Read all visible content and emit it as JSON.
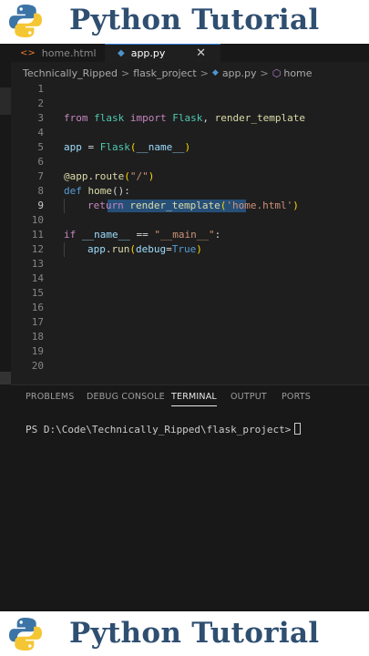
{
  "banner": {
    "title": "Python Tutorial"
  },
  "tabs": [
    {
      "label": "home.html",
      "icon": "<>"
    },
    {
      "label": "app.py",
      "icon": "◆"
    }
  ],
  "breadcrumb": {
    "items": [
      "Technically_Ripped",
      "flask_project",
      "app.py",
      "home"
    ],
    "separator": ">"
  },
  "editor": {
    "line_numbers": [
      "1",
      "2",
      "3",
      "4",
      "5",
      "6",
      "7",
      "8",
      "9",
      "10",
      "11",
      "12",
      "13",
      "14",
      "15",
      "16",
      "17",
      "18",
      "19",
      "20"
    ],
    "code": {
      "l3_from": "from",
      "l3_mod": "flask",
      "l3_import": "import",
      "l3_cls": "Flask",
      "l3_comma": ",",
      "l3_fn": "render_template",
      "l5_app": "app",
      "l5_eq": "=",
      "l5_cls": "Flask",
      "l5_open": "(",
      "l5_name": "__name__",
      "l5_close": ")",
      "l7_dec": "@app.route",
      "l7_open": "(",
      "l7_str": "\"/\"",
      "l7_close": ")",
      "l8_def": "def",
      "l8_fn": "home",
      "l8_rest": "():",
      "l9_return": "return",
      "l9_fn": "render_template",
      "l9_open": "(",
      "l9_str": "'home.html'",
      "l9_close": ")",
      "l11_if": "if",
      "l11_name": "__name__",
      "l11_eq": "==",
      "l11_str": "\"__main__\"",
      "l11_colon": ":",
      "l12_app": "app",
      "l12_dot": ".",
      "l12_fn": "run",
      "l12_open": "(",
      "l12_arg": "debug",
      "l12_eq": "=",
      "l12_true": "True",
      "l12_close": ")"
    }
  },
  "panel": {
    "tabs": [
      "PROBLEMS",
      "DEBUG CONSOLE",
      "TERMINAL",
      "OUTPUT",
      "PORTS"
    ],
    "active_tab": "TERMINAL",
    "terminal_prompt": "PS D:\\Code\\Technically_Ripped\\flask_project>"
  },
  "colors": {
    "banner_text": "#2f4f71",
    "editor_bg": "#1e1e1e",
    "keyword": "#c586c0",
    "class": "#4ec9b0",
    "function": "#dcdcaa",
    "string": "#ce9178",
    "selection": "#264f78"
  }
}
